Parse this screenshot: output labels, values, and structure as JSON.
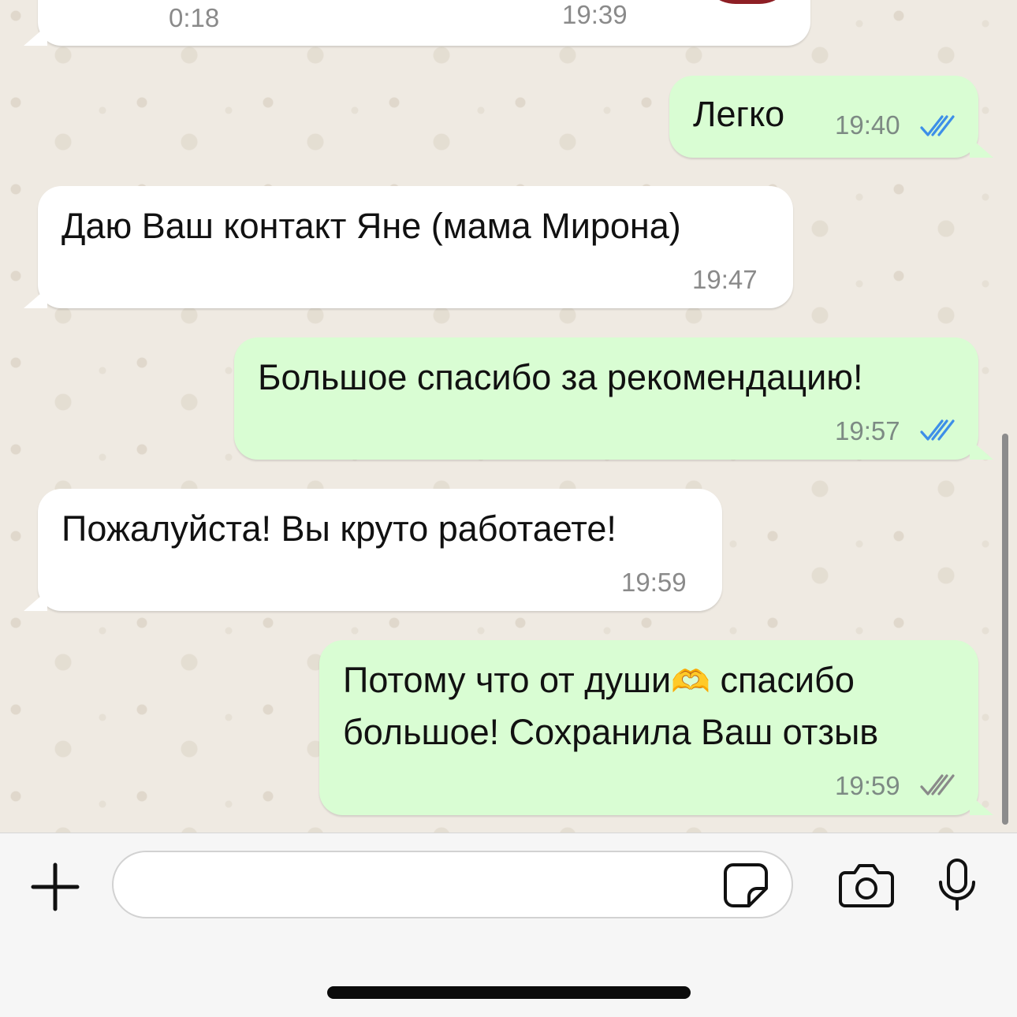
{
  "messages": [
    {
      "id": "partial-top",
      "direction": "in",
      "left_time": "0:18",
      "time": "19:39"
    },
    {
      "id": "m1",
      "direction": "out",
      "text": "Легко",
      "time": "19:40",
      "status": "read"
    },
    {
      "id": "m2",
      "direction": "in",
      "text": "Даю Ваш контакт Яне (мама Мирона)",
      "time": "19:47"
    },
    {
      "id": "m3",
      "direction": "out",
      "text": "Большое спасибо за рекомендацию!",
      "time": "19:57",
      "status": "read"
    },
    {
      "id": "m4",
      "direction": "in",
      "text": "Пожалуйста! Вы круто работаете!",
      "time": "19:59"
    },
    {
      "id": "m5",
      "direction": "out",
      "text_line1": "Потому что от души",
      "emoji": "🫶",
      "text_line1_end": "спасибо",
      "text_line2": "большое! Сохранила Ваш отзыв",
      "time": "19:59",
      "status": "delivered"
    }
  ],
  "input": {
    "placeholder": "",
    "value": ""
  },
  "icons": {
    "attach": "plus-icon",
    "sticker": "sticker-icon",
    "camera": "camera-icon",
    "mic": "microphone-icon"
  },
  "colors": {
    "incoming_bubble": "#ffffff",
    "outgoing_bubble": "#d9fdd3",
    "read_ticks": "#3d8fe8",
    "delivered_ticks": "#8a8a8a",
    "wallpaper": "#efeae2"
  }
}
